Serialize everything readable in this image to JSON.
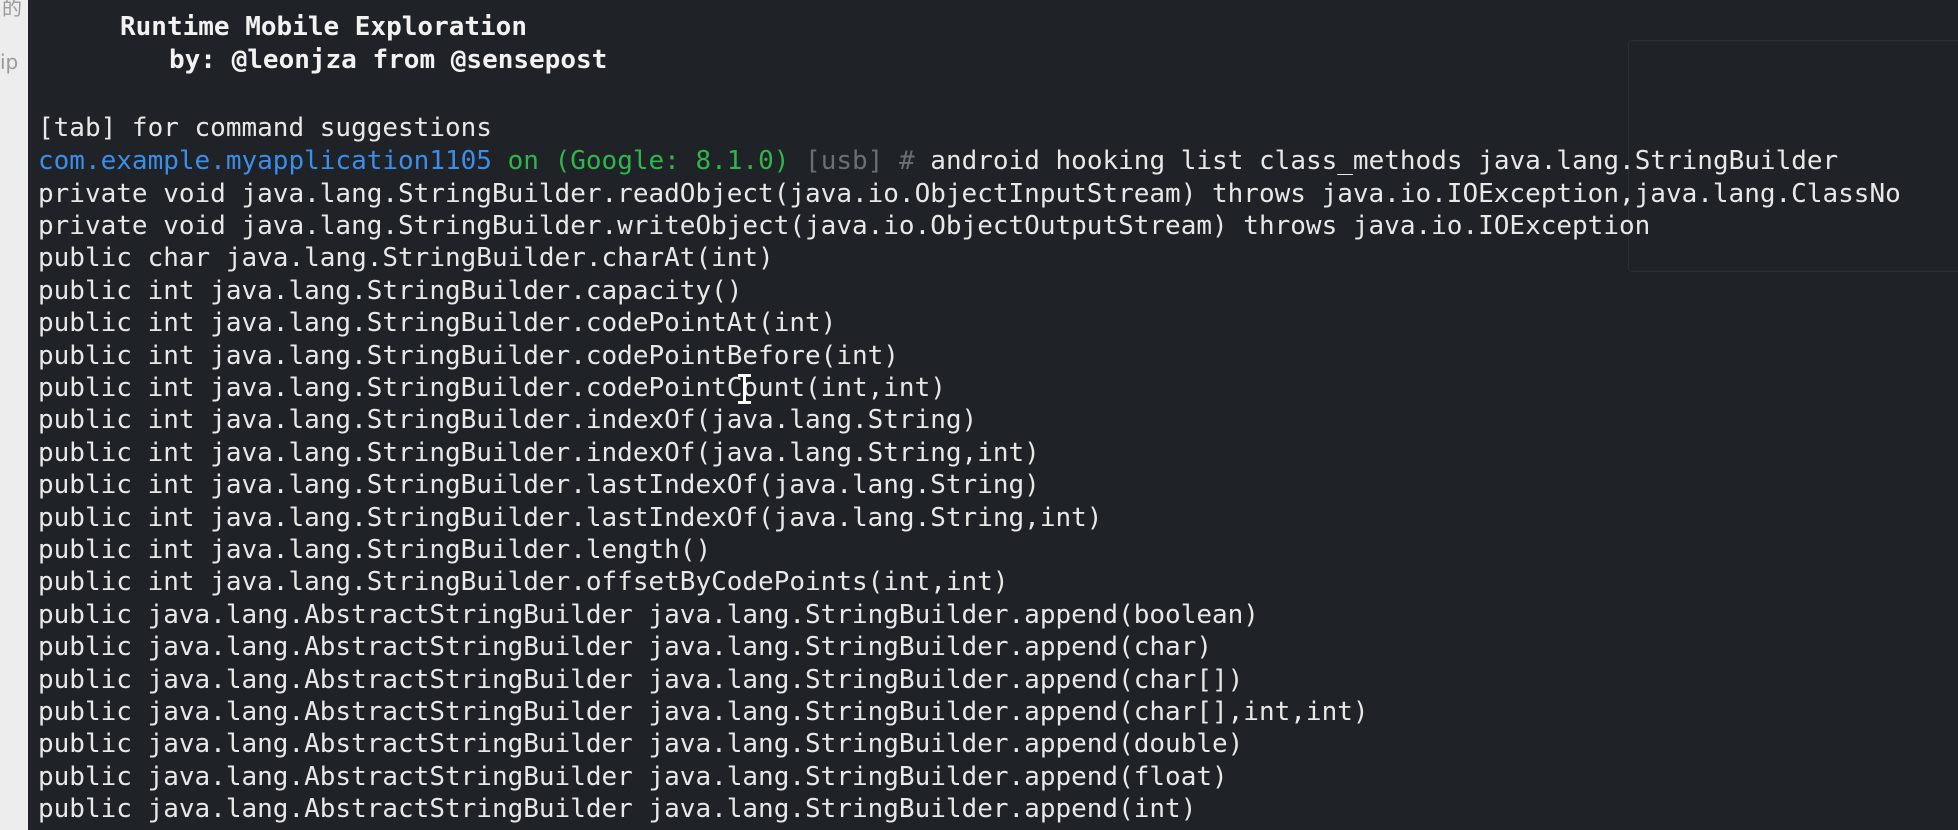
{
  "left_strip": {
    "fragment_top": "的",
    "fragment_mid": "ip"
  },
  "banner": {
    "title": "Runtime Mobile Exploration",
    "byline": "by: @leonjza from @sensepost"
  },
  "hint": "[tab] for command suggestions",
  "prompt": {
    "package": "com.example.myapplication1105",
    "on_word": "on",
    "device": "(Google: 8.1.0)",
    "transport": "[usb]",
    "symbol": "#",
    "command": "android hooking list class_methods java.lang.StringBuilder"
  },
  "output_lines": [
    "private void java.lang.StringBuilder.readObject(java.io.ObjectInputStream) throws java.io.IOException,java.lang.ClassNo",
    "private void java.lang.StringBuilder.writeObject(java.io.ObjectOutputStream) throws java.io.IOException",
    "public char java.lang.StringBuilder.charAt(int)",
    "public int java.lang.StringBuilder.capacity()",
    "public int java.lang.StringBuilder.codePointAt(int)",
    "public int java.lang.StringBuilder.codePointBefore(int)",
    "public int java.lang.StringBuilder.codePointCount(int,int)",
    "public int java.lang.StringBuilder.indexOf(java.lang.String)",
    "public int java.lang.StringBuilder.indexOf(java.lang.String,int)",
    "public int java.lang.StringBuilder.lastIndexOf(java.lang.String)",
    "public int java.lang.StringBuilder.lastIndexOf(java.lang.String,int)",
    "public int java.lang.StringBuilder.length()",
    "public int java.lang.StringBuilder.offsetByCodePoints(int,int)",
    "public java.lang.AbstractStringBuilder java.lang.StringBuilder.append(boolean)",
    "public java.lang.AbstractStringBuilder java.lang.StringBuilder.append(char)",
    "public java.lang.AbstractStringBuilder java.lang.StringBuilder.append(char[])",
    "public java.lang.AbstractStringBuilder java.lang.StringBuilder.append(char[],int,int)",
    "public java.lang.AbstractStringBuilder java.lang.StringBuilder.append(double)",
    "public java.lang.AbstractStringBuilder java.lang.StringBuilder.append(float)",
    "public java.lang.AbstractStringBuilder java.lang.StringBuilder.append(int)"
  ],
  "colors": {
    "terminal_bg": "#1f2226",
    "text": "#e8e8e8",
    "package": "#3b8eea",
    "on": "#2fb64a",
    "usb": "#6b6f75"
  },
  "icons": {
    "cursor": "text-cursor-icon"
  }
}
